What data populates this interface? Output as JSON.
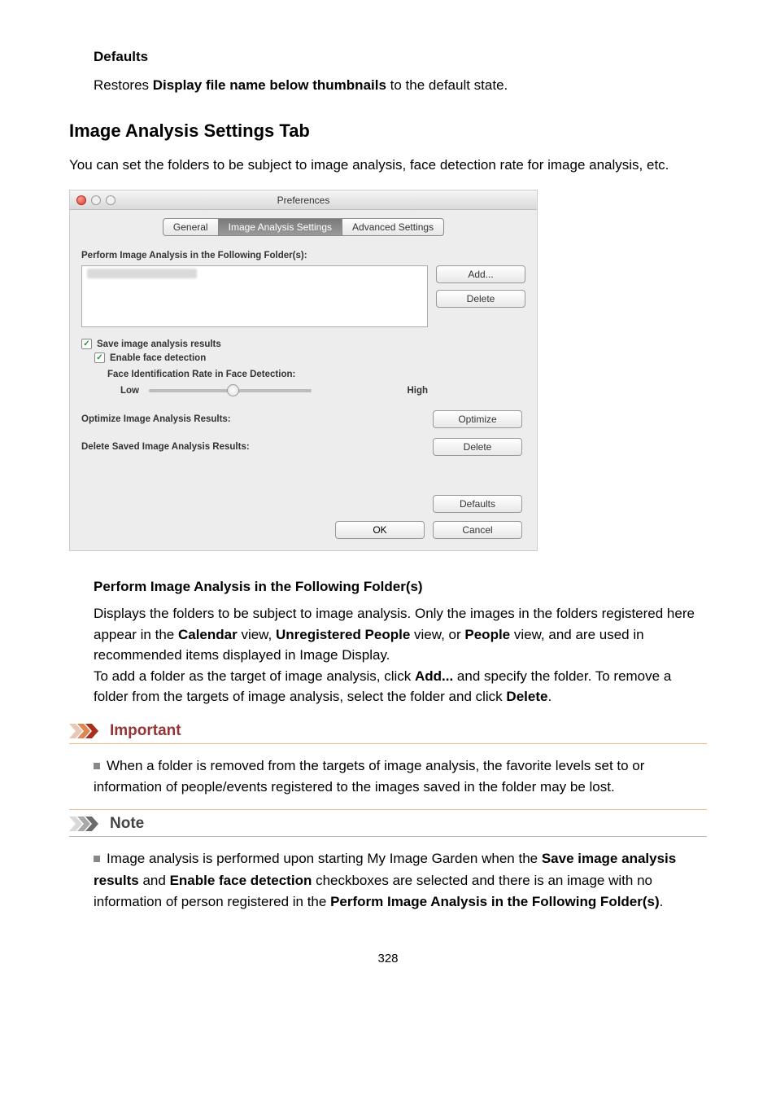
{
  "defaults_section": {
    "heading": "Defaults",
    "text_pre": "Restores ",
    "text_bold": "Display file name below thumbnails",
    "text_post": " to the default state."
  },
  "main_heading": "Image Analysis Settings Tab",
  "intro": "You can set the folders to be subject to image analysis, face detection rate for image analysis, etc.",
  "dialog": {
    "title": "Preferences",
    "tabs": {
      "general": "General",
      "ias": "Image Analysis Settings",
      "adv": "Advanced Settings"
    },
    "perform_label": "Perform Image Analysis in the Following Folder(s):",
    "btn_add": "Add...",
    "btn_delete": "Delete",
    "chk_save": "Save image analysis results",
    "chk_face": "Enable face detection",
    "face_rate_label": "Face Identification Rate in Face Detection:",
    "slider_low": "Low",
    "slider_high": "High",
    "optimize_label": "Optimize Image Analysis Results:",
    "btn_optimize": "Optimize",
    "delete_saved_label": "Delete Saved Image Analysis Results:",
    "btn_delete2": "Delete",
    "btn_defaults": "Defaults",
    "btn_ok": "OK",
    "btn_cancel": "Cancel"
  },
  "perform_expl": {
    "heading": "Perform Image Analysis in the Following Folder(s)",
    "p1a": "Displays the folders to be subject to image analysis. Only the images in the folders registered here appear in the ",
    "p1_cal": "Calendar",
    "p1b": " view, ",
    "p1_unreg": "Unregistered People",
    "p1c": " view, or ",
    "p1_people": "People",
    "p1d": " view, and are used in recommended items displayed in Image Display.",
    "p2a": "To add a folder as the target of image analysis, click ",
    "p2_add": "Add...",
    "p2b": " and specify the folder. To remove a folder from the targets of image analysis, select the folder and click ",
    "p2_del": "Delete",
    "p2c": "."
  },
  "important": {
    "label": "Important",
    "body": "When a folder is removed from the targets of image analysis, the favorite levels set to or information of people/events registered to the images saved in the folder may be lost."
  },
  "note": {
    "label": "Note",
    "b1a": "Image analysis is performed upon starting My Image Garden when the ",
    "b1_save": "Save image analysis results",
    "b1b": " and ",
    "b1_face": "Enable face detection",
    "b1c": " checkboxes are selected and there is an image with no information of person registered in the ",
    "b1_perf": "Perform Image Analysis in the Following Folder(s)",
    "b1d": "."
  },
  "page_number": "328"
}
